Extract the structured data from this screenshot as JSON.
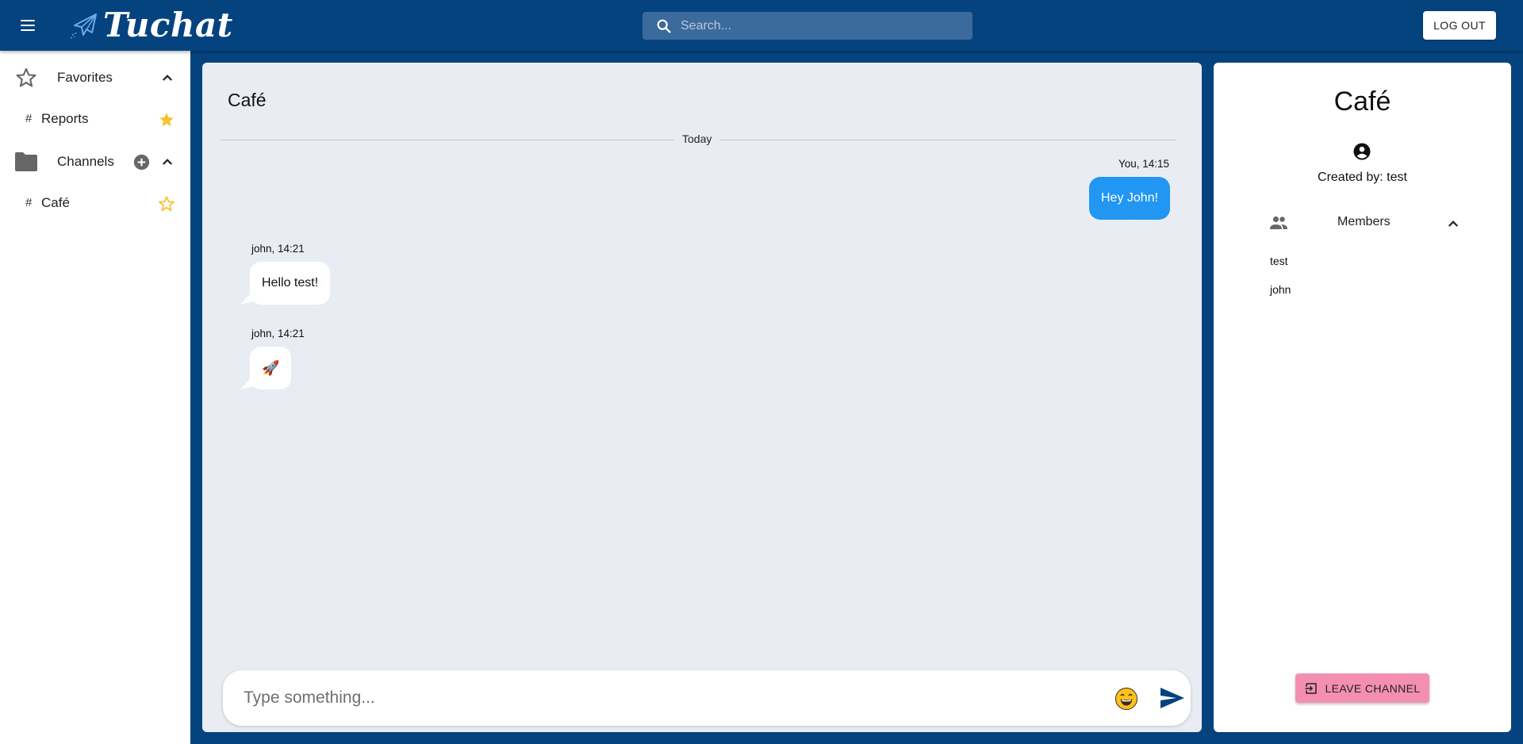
{
  "header": {
    "app_name": "Tuchat",
    "search_placeholder": "Search...",
    "logout_label": "LOG OUT"
  },
  "sidebar": {
    "favorites_label": "Favorites",
    "favorites": [
      {
        "hash": "#",
        "name": "Reports",
        "starred": true
      }
    ],
    "channels_label": "Channels",
    "channels": [
      {
        "hash": "#",
        "name": "Café",
        "starred": false
      }
    ]
  },
  "chat": {
    "title": "Café",
    "date_divider": "Today",
    "messages": [
      {
        "meta": "You, 14:15",
        "text": "Hey John!",
        "mine": true
      },
      {
        "meta": "john, 14:21",
        "text": "Hello test!",
        "mine": false
      },
      {
        "meta": "john, 14:21",
        "text": "🚀",
        "mine": false
      }
    ],
    "composer_placeholder": "Type something..."
  },
  "info": {
    "title": "Café",
    "created_by": "Created by: test",
    "members_label": "Members",
    "members": [
      "test",
      "john"
    ],
    "leave_label": "LEAVE CHANNEL"
  },
  "colors": {
    "brand": "#05437f",
    "my_bubble": "#2196f3",
    "star": "#fbc02d",
    "leave": "#f48fb1"
  },
  "icons": [
    "menu-icon",
    "paper-plane-logo-icon",
    "search-icon",
    "star-icon",
    "folder-icon",
    "add-circle-icon",
    "chevron-up-icon",
    "account-circle-icon",
    "people-icon",
    "emoji-icon",
    "send-icon",
    "exit-icon"
  ]
}
